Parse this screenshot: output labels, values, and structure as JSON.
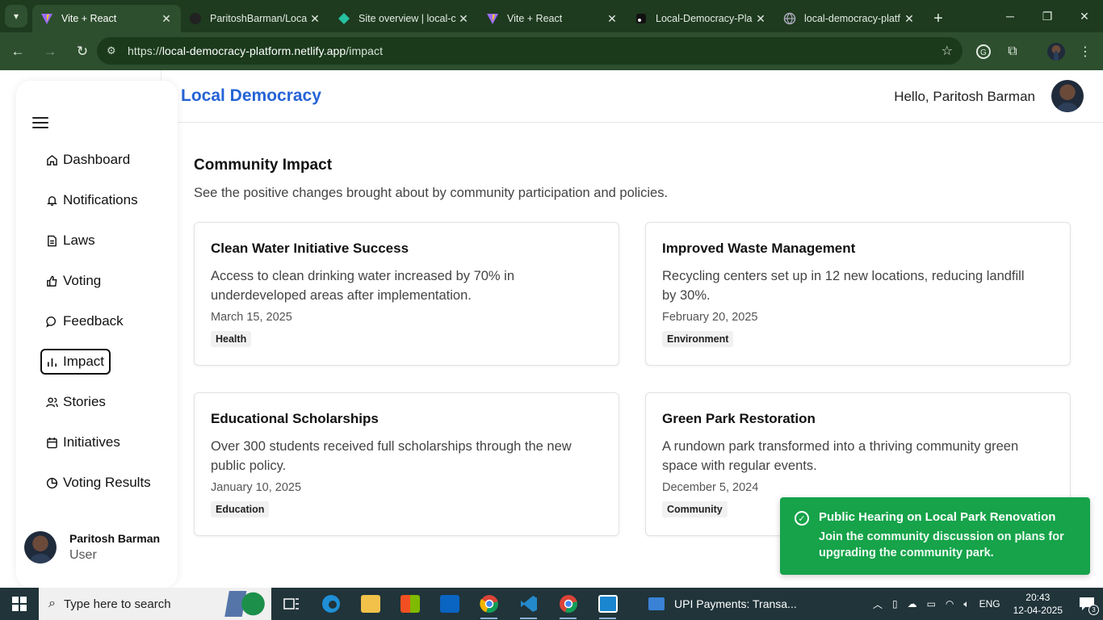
{
  "browser": {
    "tabs": [
      {
        "title": "Vite + React",
        "active": true
      },
      {
        "title": "ParitoshBarman/Loca",
        "active": false
      },
      {
        "title": "Site overview | local-c",
        "active": false
      },
      {
        "title": "Vite + React",
        "active": false
      },
      {
        "title": "Local-Democracy-Pla",
        "active": false
      },
      {
        "title": "local-democracy-platf",
        "active": false
      }
    ],
    "url_prefix": "https://",
    "url_host": "local-democracy-platform.netlify.app",
    "url_path": "/impact"
  },
  "header": {
    "brand": "Local Democracy",
    "greeting": "Hello, Paritosh Barman"
  },
  "sidebar": {
    "items": [
      {
        "label": "Dashboard",
        "icon": "home-icon"
      },
      {
        "label": "Notifications",
        "icon": "bell-icon"
      },
      {
        "label": "Laws",
        "icon": "document-icon"
      },
      {
        "label": "Voting",
        "icon": "thumbs-up-icon"
      },
      {
        "label": "Feedback",
        "icon": "message-icon"
      },
      {
        "label": "Impact",
        "icon": "bar-chart-icon",
        "active": true
      },
      {
        "label": "Stories",
        "icon": "users-icon"
      },
      {
        "label": "Initiatives",
        "icon": "calendar-icon"
      },
      {
        "label": "Voting Results",
        "icon": "pie-chart-icon"
      }
    ],
    "user": {
      "name": "Paritosh Barman",
      "role": "User"
    }
  },
  "main": {
    "title": "Community Impact",
    "subtitle": "See the positive changes brought about by community participation and policies.",
    "cards": [
      {
        "title": "Clean Water Initiative Success",
        "body": "Access to clean drinking water increased by 70% in underdeveloped areas after implementation.",
        "date": "March 15, 2025",
        "tag": "Health"
      },
      {
        "title": "Improved Waste Management",
        "body": "Recycling centers set up in 12 new locations, reducing landfill by 30%.",
        "date": "February 20, 2025",
        "tag": "Environment"
      },
      {
        "title": "Educational Scholarships",
        "body": "Over 300 students received full scholarships through the new public policy.",
        "date": "January 10, 2025",
        "tag": "Education"
      },
      {
        "title": "Green Park Restoration",
        "body": "A rundown park transformed into a thriving community green space with regular events.",
        "date": "December 5, 2024",
        "tag": "Community"
      }
    ]
  },
  "toast": {
    "title": "Public Hearing on Local Park Renovation",
    "body": "Join the community discussion on plans for upgrading the community park."
  },
  "taskbar": {
    "search_placeholder": "Type here to search",
    "running_app": "UPI Payments: Transa...",
    "language": "ENG",
    "time": "20:43",
    "date": "12-04-2025",
    "notification_count": "3"
  },
  "colors": {
    "accent": "#2563d6",
    "toast": "#16a34a",
    "chrome": "#1e3a1f"
  }
}
